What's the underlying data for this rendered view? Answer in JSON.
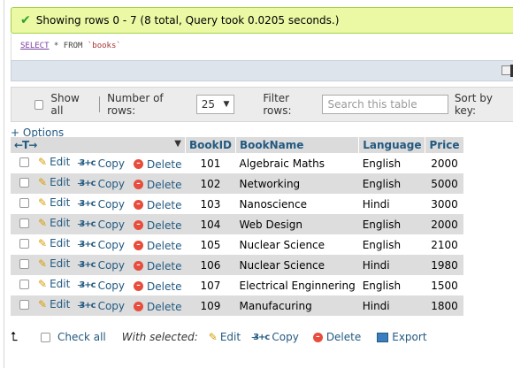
{
  "message": {
    "text": "Showing rows 0 - 7 (8 total, Query took 0.0205 seconds.)"
  },
  "query": {
    "select": "SELECT",
    "rest": " * FROM ",
    "table": "`books`"
  },
  "nav": {
    "show_all": "Show all",
    "rows_label": "Number of rows:",
    "rows_value": "25",
    "filter_label": "Filter rows:",
    "filter_placeholder": "Search this table",
    "sort_label": "Sort by key:"
  },
  "options_link": "+ Options",
  "columns": [
    "BookID",
    "BookName",
    "Language",
    "Price"
  ],
  "actions": {
    "edit": "Edit",
    "copy": "Copy",
    "delete": "Delete"
  },
  "rows": [
    {
      "id": "101",
      "name": "Algebraic Maths",
      "lang": "English",
      "price": "2000"
    },
    {
      "id": "102",
      "name": "Networking",
      "lang": "English",
      "price": "5000"
    },
    {
      "id": "103",
      "name": "Nanoscience",
      "lang": "Hindi",
      "price": "3000"
    },
    {
      "id": "104",
      "name": "Web Design",
      "lang": "English",
      "price": "2000"
    },
    {
      "id": "105",
      "name": "Nuclear Science",
      "lang": "English",
      "price": "2100"
    },
    {
      "id": "106",
      "name": "Nuclear Science",
      "lang": "Hindi",
      "price": "1980"
    },
    {
      "id": "107",
      "name": "Electrical Enginnering",
      "lang": "English",
      "price": "1500"
    },
    {
      "id": "109",
      "name": "Manufacuring",
      "lang": "Hindi",
      "price": "1800"
    }
  ],
  "footer": {
    "check_all": "Check all",
    "with_selected": "With selected:",
    "edit": "Edit",
    "copy": "Copy",
    "delete": "Delete",
    "export": "Export"
  },
  "colors": {
    "accent": "#235a81",
    "success_bg": "#ebf8a4",
    "row_alt": "#dddddd"
  }
}
